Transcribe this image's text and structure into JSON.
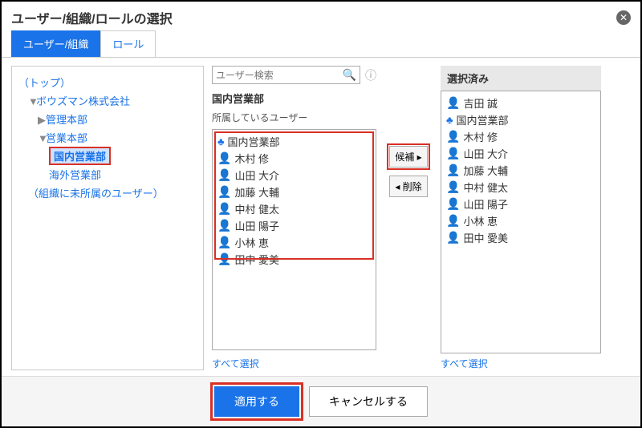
{
  "title": "ユーザー/組織/ロールの選択",
  "tabs": {
    "userOrg": "ユーザー/組織",
    "role": "ロール"
  },
  "tree": {
    "top": "（トップ）",
    "company": "ボウズマン株式会社",
    "dept1": "管理本部",
    "dept2": "営業本部",
    "dept2a": "国内営業部",
    "dept2b": "海外営業部",
    "unassigned": "（組織に未所属のユーザー）"
  },
  "search": {
    "placeholder": "ユーザー検索"
  },
  "center": {
    "deptTitle": "国内営業部",
    "subLabel": "所属しているユーザー",
    "users": [
      {
        "type": "org",
        "name": "国内営業部"
      },
      {
        "type": "user",
        "name": "木村 修"
      },
      {
        "type": "user",
        "name": "山田 大介"
      },
      {
        "type": "user",
        "name": "加藤 大輔"
      },
      {
        "type": "user",
        "name": "中村 健太"
      },
      {
        "type": "user",
        "name": "山田 陽子"
      },
      {
        "type": "user",
        "name": "小林 恵"
      },
      {
        "type": "user",
        "name": "田中 愛美"
      }
    ],
    "selectAll": "すべて選択"
  },
  "ops": {
    "add": "候補",
    "remove": "削除"
  },
  "right": {
    "header": "選択済み",
    "items": [
      {
        "type": "user",
        "name": "吉田 誠"
      },
      {
        "type": "org",
        "name": "国内営業部"
      },
      {
        "type": "user",
        "name": "木村 修"
      },
      {
        "type": "user",
        "name": "山田 大介"
      },
      {
        "type": "user",
        "name": "加藤 大輔"
      },
      {
        "type": "user",
        "name": "中村 健太"
      },
      {
        "type": "user",
        "name": "山田 陽子"
      },
      {
        "type": "user",
        "name": "小林 恵"
      },
      {
        "type": "user",
        "name": "田中 愛美"
      }
    ],
    "selectAll": "すべて選択"
  },
  "footer": {
    "apply": "適用する",
    "cancel": "キャンセルする"
  }
}
